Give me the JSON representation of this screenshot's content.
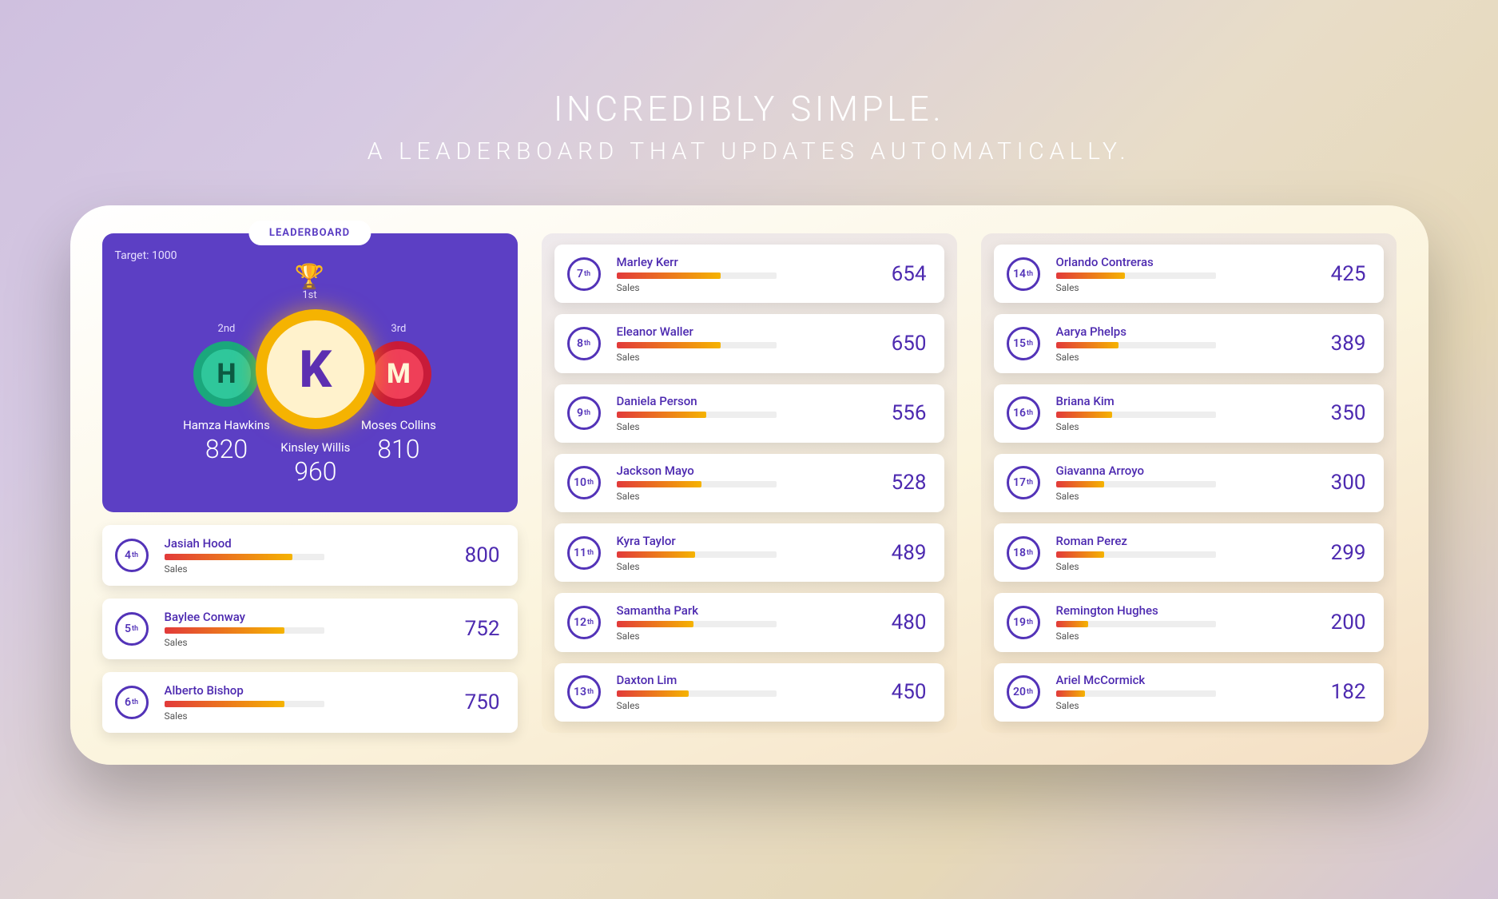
{
  "hero": {
    "title": "INCREDIBLY SIMPLE.",
    "subtitle": "A LEADERBOARD THAT UPDATES AUTOMATICALLY."
  },
  "leaderboard": {
    "badge": "LEADERBOARD",
    "target_label": "Target: 1000",
    "target": 1000,
    "category": "Sales",
    "pod_labels": {
      "first": "1st",
      "second": "2nd",
      "third": "3rd"
    },
    "podium": {
      "first": {
        "initial": "K",
        "name": "Kinsley Willis",
        "score": 960
      },
      "second": {
        "initial": "H",
        "name": "Hamza Hawkins",
        "score": 820
      },
      "third": {
        "initial": "M",
        "name": "Moses Collins",
        "score": 810
      }
    },
    "rest": [
      {
        "rank": 4,
        "name": "Jasiah Hood",
        "score": 800
      },
      {
        "rank": 5,
        "name": "Baylee Conway",
        "score": 752
      },
      {
        "rank": 6,
        "name": "Alberto Bishop",
        "score": 750
      },
      {
        "rank": 7,
        "name": "Marley Kerr",
        "score": 654
      },
      {
        "rank": 8,
        "name": "Eleanor Waller",
        "score": 650
      },
      {
        "rank": 9,
        "name": "Daniela Person",
        "score": 556
      },
      {
        "rank": 10,
        "name": "Jackson Mayo",
        "score": 528
      },
      {
        "rank": 11,
        "name": "Kyra Taylor",
        "score": 489
      },
      {
        "rank": 12,
        "name": "Samantha Park",
        "score": 480
      },
      {
        "rank": 13,
        "name": "Daxton Lim",
        "score": 450
      },
      {
        "rank": 14,
        "name": "Orlando Contreras",
        "score": 425
      },
      {
        "rank": 15,
        "name": "Aarya Phelps",
        "score": 389
      },
      {
        "rank": 16,
        "name": "Briana Kim",
        "score": 350
      },
      {
        "rank": 17,
        "name": "Giavanna Arroyo",
        "score": 300
      },
      {
        "rank": 18,
        "name": "Roman Perez",
        "score": 299
      },
      {
        "rank": 19,
        "name": "Remington Hughes",
        "score": 200
      },
      {
        "rank": 20,
        "name": "Ariel McCormick",
        "score": 182
      }
    ]
  }
}
